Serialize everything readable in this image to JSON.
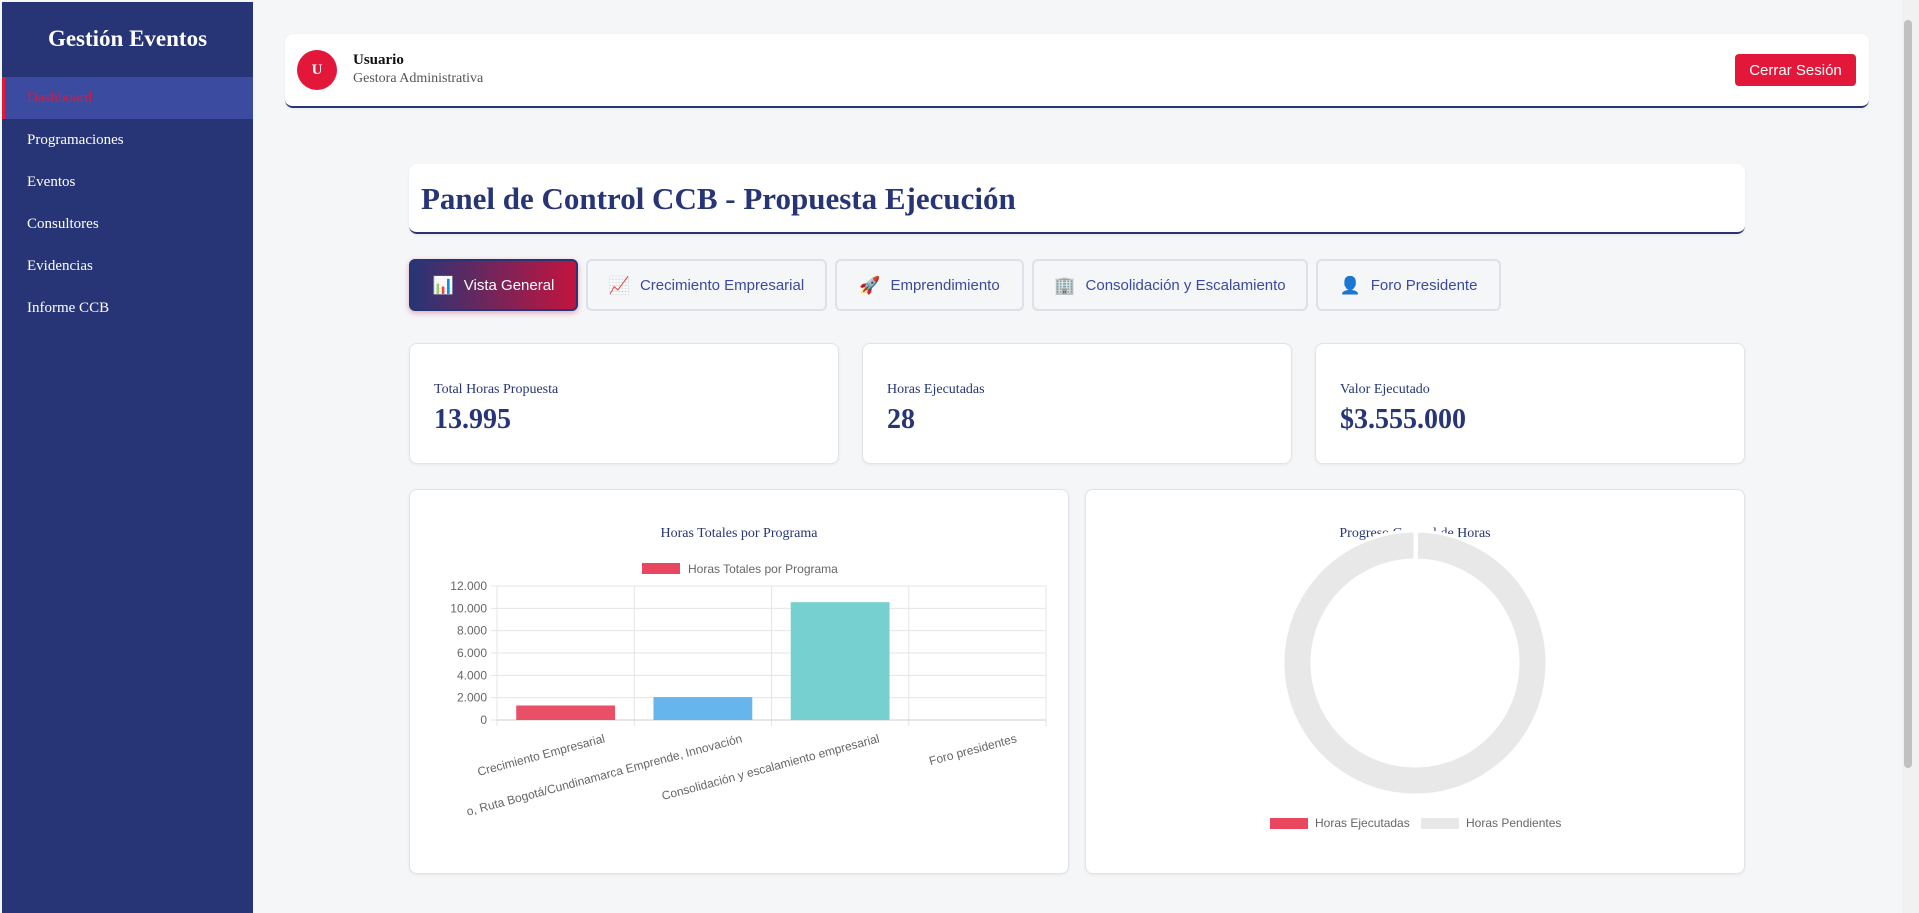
{
  "sidebar": {
    "brand": "Gestión Eventos",
    "items": [
      {
        "label": "Dashboard",
        "active": true
      },
      {
        "label": "Programaciones"
      },
      {
        "label": "Eventos"
      },
      {
        "label": "Consultores"
      },
      {
        "label": "Evidencias"
      },
      {
        "label": "Informe CCB"
      }
    ]
  },
  "header": {
    "avatar_letter": "U",
    "user_name": "Usuario",
    "user_role": "Gestora Administrativa",
    "logout_label": "Cerrar Sesión"
  },
  "main": {
    "title": "Panel de Control CCB - Propuesta Ejecución",
    "tabs": [
      {
        "label": "Vista General",
        "icon": "📊",
        "icon_name": "bar-chart-icon",
        "active": true
      },
      {
        "label": "Crecimiento Empresarial",
        "icon": "📈",
        "icon_name": "trend-up-icon"
      },
      {
        "label": "Emprendimiento",
        "icon": "🚀",
        "icon_name": "rocket-icon"
      },
      {
        "label": "Consolidación y Escalamiento",
        "icon": "🏢",
        "icon_name": "building-icon"
      },
      {
        "label": "Foro Presidente",
        "icon": "👤",
        "icon_name": "person-icon"
      }
    ],
    "stats": [
      {
        "label": "Total Horas Propuesta",
        "value": "13.995"
      },
      {
        "label": "Horas Ejecutadas",
        "value": "28"
      },
      {
        "label": "Valor Ejecutado",
        "value": "$3.555.000"
      }
    ]
  },
  "chart_data": [
    {
      "type": "bar",
      "title": "Horas Totales por Programa",
      "categories": [
        "Crecimiento Empresarial",
        "o, Ruta Bogotá/Cundinamarca Emprende, Innovación",
        "Consolidación y escalamiento empresarial",
        "Foro presidentes"
      ],
      "series": [
        {
          "name": "Horas Totales por Programa",
          "values": [
            1300,
            2050,
            10550,
            0
          ]
        }
      ],
      "bar_colors": [
        "#e8475f",
        "#5eb2ec",
        "#6ecdcc",
        "#f3c054"
      ],
      "yticks": [
        "0",
        "2.000",
        "4.000",
        "6.000",
        "8.000",
        "10.000",
        "12.000"
      ],
      "ylim": [
        0,
        12000
      ],
      "legend": "top",
      "grid": true
    },
    {
      "type": "pie",
      "title": "Progreso General de Horas",
      "labels": [
        "Horas Ejecutadas",
        "Horas Pendientes"
      ],
      "values": [
        28,
        13967
      ],
      "colors": [
        "#e8475f",
        "#e8e8e8"
      ],
      "legend": "bottom"
    }
  ]
}
